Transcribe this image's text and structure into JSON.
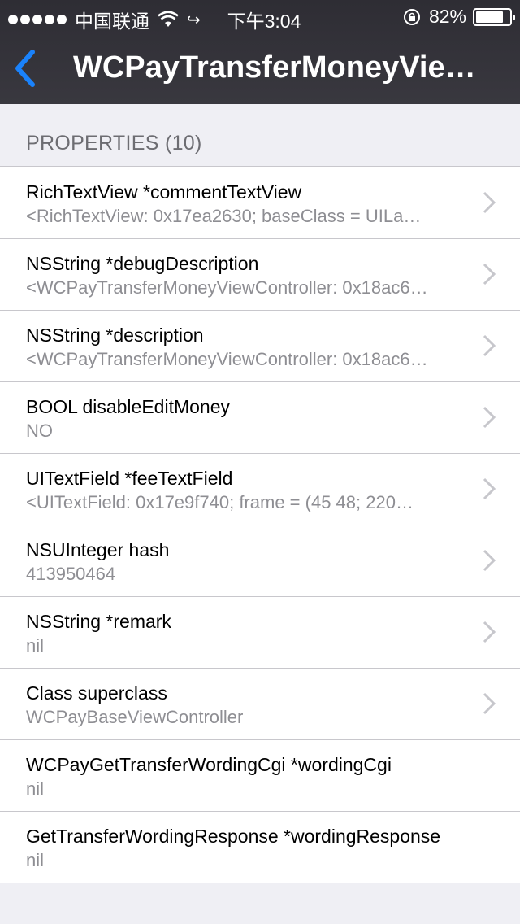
{
  "status_bar": {
    "carrier": "中国联通",
    "time": "下午3:04",
    "battery_percent": "82%",
    "battery_level": 0.82
  },
  "nav": {
    "title": "WCPayTransferMoneyVie…"
  },
  "section": {
    "header": "PROPERTIES (10)"
  },
  "properties": [
    {
      "title": "RichTextView *commentTextView",
      "value": "<RichTextView: 0x17ea2630; baseClass = UILa…",
      "has_chevron": true
    },
    {
      "title": "NSString *debugDescription",
      "value": "<WCPayTransferMoneyViewController: 0x18ac6…",
      "has_chevron": true
    },
    {
      "title": "NSString *description",
      "value": "<WCPayTransferMoneyViewController: 0x18ac6…",
      "has_chevron": true
    },
    {
      "title": "BOOL disableEditMoney",
      "value": "NO",
      "has_chevron": true
    },
    {
      "title": "UITextField *feeTextField",
      "value": "<UITextField: 0x17e9f740; frame = (45 48; 220…",
      "has_chevron": true
    },
    {
      "title": "NSUInteger hash",
      "value": "413950464",
      "has_chevron": true
    },
    {
      "title": "NSString *remark",
      "value": "nil",
      "has_chevron": true
    },
    {
      "title": "Class superclass",
      "value": "WCPayBaseViewController",
      "has_chevron": true
    },
    {
      "title": "WCPayGetTransferWordingCgi *wordingCgi",
      "value": "nil",
      "has_chevron": false
    },
    {
      "title": "GetTransferWordingResponse *wordingResponse",
      "value": "nil",
      "has_chevron": false
    }
  ],
  "colors": {
    "accent": "#1a82fb",
    "chevron": "#c7c7cc"
  }
}
